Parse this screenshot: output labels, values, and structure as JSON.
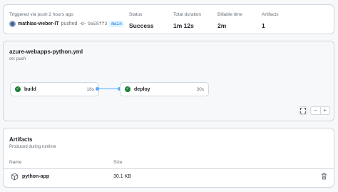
{
  "summary": {
    "trigger_text": "Triggered via push 2 hours ago",
    "actor": "mathias-weber-IT",
    "action": "pushed",
    "commit_sha": "9a58ff3",
    "branch": "main",
    "status_label": "Status",
    "status_value": "Success",
    "duration_label": "Total duration",
    "duration_value": "1m 12s",
    "billable_label": "Billable time",
    "billable_value": "2m",
    "artifacts_label": "Artifacts",
    "artifacts_value": "1"
  },
  "workflow": {
    "file": "azure-webapps-python.yml",
    "event": "on: push",
    "jobs": [
      {
        "name": "build",
        "duration": "18s",
        "status": "success"
      },
      {
        "name": "deploy",
        "duration": "30s",
        "status": "success"
      }
    ],
    "controls": {
      "fullscreen_icon": "fullscreen-icon",
      "zoom_out": "−",
      "zoom_in": "+"
    }
  },
  "artifacts": {
    "title": "Artifacts",
    "subtitle": "Produced during runtime",
    "columns": {
      "name": "Name",
      "size": "Size"
    },
    "items": [
      {
        "name": "python-app",
        "size": "30.1 KB"
      }
    ]
  },
  "colors": {
    "success": "#1a7f37",
    "link": "#0969da",
    "connector": "#54aeff",
    "border": "#d0d7de"
  }
}
